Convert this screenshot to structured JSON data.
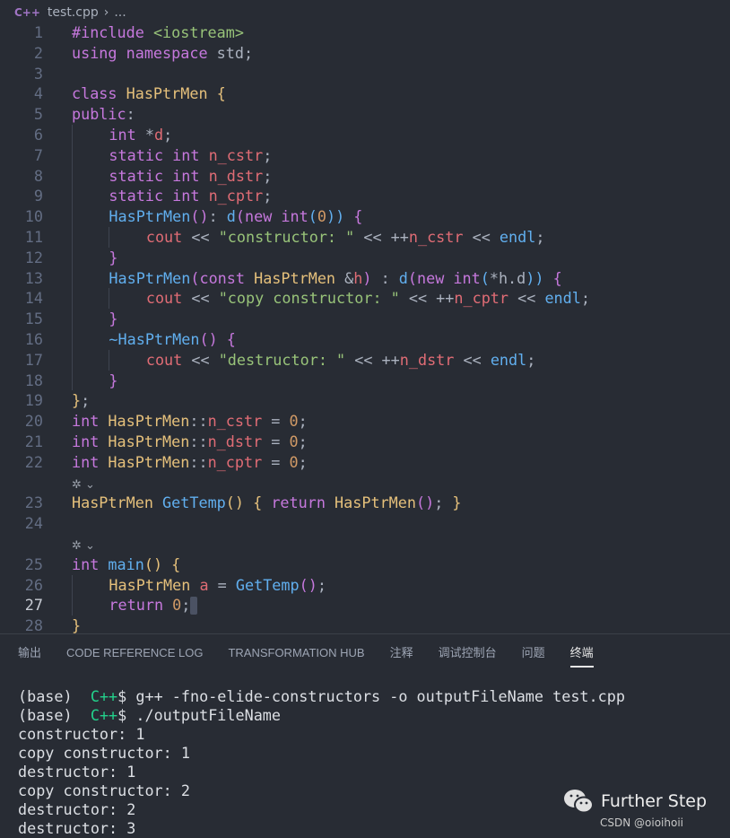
{
  "breadcrumb": {
    "lang_icon": "C++",
    "file": "test.cpp",
    "more": "..."
  },
  "codelens_icon": "codelens-icon",
  "editor": {
    "current_line": 27,
    "rows": [
      {
        "n": 1,
        "t": [
          [
            "kw",
            "#include "
          ],
          [
            "st",
            "<iostream>"
          ]
        ]
      },
      {
        "n": 2,
        "t": [
          [
            "kw",
            "using namespace "
          ],
          [
            "pl",
            "std;"
          ]
        ]
      },
      {
        "n": 3,
        "t": []
      },
      {
        "n": 4,
        "t": [
          [
            "kw",
            "class "
          ],
          [
            "ty",
            "HasPtrMen "
          ],
          [
            "br",
            "{"
          ]
        ]
      },
      {
        "n": 5,
        "t": [
          [
            "kw",
            "public"
          ],
          [
            "pl",
            ":"
          ]
        ]
      },
      {
        "n": 6,
        "i": 1,
        "t": [
          [
            "kw",
            "int "
          ],
          [
            "pl",
            "*"
          ],
          [
            "va",
            "d"
          ],
          [
            "pl",
            ";"
          ]
        ]
      },
      {
        "n": 7,
        "i": 1,
        "t": [
          [
            "kw",
            "static int "
          ],
          [
            "va",
            "n_cstr"
          ],
          [
            "pl",
            ";"
          ]
        ]
      },
      {
        "n": 8,
        "i": 1,
        "t": [
          [
            "kw",
            "static int "
          ],
          [
            "va",
            "n_dstr"
          ],
          [
            "pl",
            ";"
          ]
        ]
      },
      {
        "n": 9,
        "i": 1,
        "t": [
          [
            "kw",
            "static int "
          ],
          [
            "va",
            "n_cptr"
          ],
          [
            "pl",
            ";"
          ]
        ]
      },
      {
        "n": 10,
        "i": 1,
        "t": [
          [
            "fn",
            "HasPtrMen"
          ],
          [
            "br2",
            "()"
          ],
          [
            "pl",
            ": "
          ],
          [
            "fn",
            "d"
          ],
          [
            "br2",
            "("
          ],
          [
            "kw",
            "new int"
          ],
          [
            "fn",
            "("
          ],
          [
            "nu",
            "0"
          ],
          [
            "fn",
            "))"
          ],
          [
            "pl",
            " "
          ],
          [
            "br2",
            "{"
          ]
        ]
      },
      {
        "n": 11,
        "i": 2,
        "t": [
          [
            "va",
            "cout "
          ],
          [
            "pl",
            "<< "
          ],
          [
            "st",
            "\"constructor: \""
          ],
          [
            "pl",
            " << ++"
          ],
          [
            "va",
            "n_cstr"
          ],
          [
            "pl",
            " << "
          ],
          [
            "fn",
            "endl"
          ],
          [
            "pl",
            ";"
          ]
        ]
      },
      {
        "n": 12,
        "i": 1,
        "t": [
          [
            "br2",
            "}"
          ]
        ]
      },
      {
        "n": 13,
        "i": 1,
        "t": [
          [
            "fn",
            "HasPtrMen"
          ],
          [
            "br2",
            "("
          ],
          [
            "kw",
            "const "
          ],
          [
            "ty",
            "HasPtrMen "
          ],
          [
            "pl",
            "&"
          ],
          [
            "va",
            "h"
          ],
          [
            "br2",
            ")"
          ],
          [
            "pl",
            " : "
          ],
          [
            "fn",
            "d"
          ],
          [
            "br2",
            "("
          ],
          [
            "kw",
            "new int"
          ],
          [
            "fn",
            "("
          ],
          [
            "pl",
            "*h.d"
          ],
          [
            "fn",
            "))"
          ],
          [
            "pl",
            " "
          ],
          [
            "br2",
            "{"
          ]
        ]
      },
      {
        "n": 14,
        "i": 2,
        "t": [
          [
            "va",
            "cout "
          ],
          [
            "pl",
            "<< "
          ],
          [
            "st",
            "\"copy constructor: \""
          ],
          [
            "pl",
            " << ++"
          ],
          [
            "va",
            "n_cptr"
          ],
          [
            "pl",
            " << "
          ],
          [
            "fn",
            "endl"
          ],
          [
            "pl",
            ";"
          ]
        ]
      },
      {
        "n": 15,
        "i": 1,
        "t": [
          [
            "br2",
            "}"
          ]
        ]
      },
      {
        "n": 16,
        "i": 1,
        "t": [
          [
            "fn",
            "~HasPtrMen"
          ],
          [
            "br2",
            "()"
          ],
          [
            "pl",
            " "
          ],
          [
            "br2",
            "{"
          ]
        ]
      },
      {
        "n": 17,
        "i": 2,
        "t": [
          [
            "va",
            "cout "
          ],
          [
            "pl",
            "<< "
          ],
          [
            "st",
            "\"destructor: \""
          ],
          [
            "pl",
            " << ++"
          ],
          [
            "va",
            "n_dstr"
          ],
          [
            "pl",
            " << "
          ],
          [
            "fn",
            "endl"
          ],
          [
            "pl",
            ";"
          ]
        ]
      },
      {
        "n": 18,
        "i": 1,
        "t": [
          [
            "br2",
            "}"
          ]
        ]
      },
      {
        "n": 19,
        "t": [
          [
            "br",
            "}"
          ],
          [
            "pl",
            ";"
          ]
        ]
      },
      {
        "n": 20,
        "t": [
          [
            "kw",
            "int "
          ],
          [
            "ty",
            "HasPtrMen"
          ],
          [
            "pl",
            "::"
          ],
          [
            "va",
            "n_cstr"
          ],
          [
            "pl",
            " = "
          ],
          [
            "nu",
            "0"
          ],
          [
            "pl",
            ";"
          ]
        ]
      },
      {
        "n": 21,
        "t": [
          [
            "kw",
            "int "
          ],
          [
            "ty",
            "HasPtrMen"
          ],
          [
            "pl",
            "::"
          ],
          [
            "va",
            "n_dstr"
          ],
          [
            "pl",
            " = "
          ],
          [
            "nu",
            "0"
          ],
          [
            "pl",
            ";"
          ]
        ]
      },
      {
        "n": 22,
        "t": [
          [
            "kw",
            "int "
          ],
          [
            "ty",
            "HasPtrMen"
          ],
          [
            "pl",
            "::"
          ],
          [
            "va",
            "n_cptr"
          ],
          [
            "pl",
            " = "
          ],
          [
            "nu",
            "0"
          ],
          [
            "pl",
            ";"
          ]
        ]
      },
      {
        "lens": true
      },
      {
        "n": 23,
        "t": [
          [
            "ty",
            "HasPtrMen "
          ],
          [
            "fn",
            "GetTemp"
          ],
          [
            "br",
            "()"
          ],
          [
            "pl",
            " "
          ],
          [
            "br",
            "{"
          ],
          [
            "kw",
            " return "
          ],
          [
            "ty",
            "HasPtrMen"
          ],
          [
            "br2",
            "()"
          ],
          [
            "pl",
            "; "
          ],
          [
            "br",
            "}"
          ]
        ]
      },
      {
        "n": 24,
        "t": []
      },
      {
        "lens": true
      },
      {
        "n": 25,
        "t": [
          [
            "kw",
            "int "
          ],
          [
            "fn",
            "main"
          ],
          [
            "br",
            "()"
          ],
          [
            "pl",
            " "
          ],
          [
            "br",
            "{"
          ]
        ]
      },
      {
        "n": 26,
        "i": 1,
        "t": [
          [
            "ty",
            "HasPtrMen "
          ],
          [
            "va",
            "a"
          ],
          [
            "pl",
            " = "
          ],
          [
            "fn",
            "GetTemp"
          ],
          [
            "br2",
            "()"
          ],
          [
            "pl",
            ";"
          ]
        ]
      },
      {
        "n": 27,
        "i": 1,
        "cursor": true,
        "t": [
          [
            "kw",
            "return "
          ],
          [
            "nu",
            "0"
          ],
          [
            "pl",
            ";"
          ]
        ]
      },
      {
        "n": 28,
        "t": [
          [
            "br",
            "}"
          ]
        ]
      }
    ]
  },
  "panel": {
    "tabs": [
      "输出",
      "CODE REFERENCE LOG",
      "TRANSFORMATION HUB",
      "注释",
      "调试控制台",
      "问题",
      "终端"
    ],
    "active_tab": "终端"
  },
  "terminal": {
    "prompts": [
      {
        "env": "(base)",
        "dir": "C++",
        "cmd": "$ g++ -fno-elide-constructors -o outputFileName test.cpp"
      },
      {
        "env": "(base)",
        "dir": "C++",
        "cmd": "$ ./outputFileName"
      }
    ],
    "output": [
      "constructor: 1",
      "copy constructor: 1",
      "destructor: 1",
      "copy constructor: 2",
      "destructor: 2",
      "destructor: 3"
    ]
  },
  "watermark": {
    "title": "Further Step",
    "sub": "CSDN @oioihoii"
  },
  "colors": {
    "background": "#282c34",
    "keyword": "#c678dd",
    "type": "#e5c07b",
    "function": "#61afef",
    "string": "#98c379",
    "number": "#d19a66",
    "variable": "#e06c75",
    "terminal_green": "#23d18b"
  }
}
